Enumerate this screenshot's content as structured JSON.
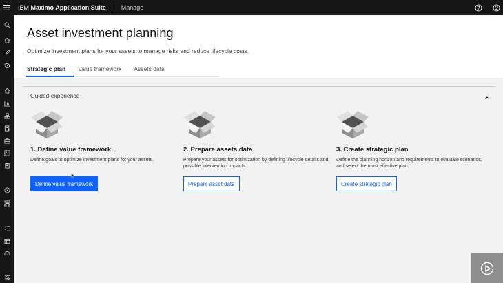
{
  "topbar": {
    "brand_prefix": "IBM",
    "brand_name": "Maximo Application Suite",
    "app_name": "Manage",
    "icons": [
      "menu-icon",
      "help-icon",
      "user-avatar-icon"
    ]
  },
  "rail": {
    "icons": [
      "search-icon",
      "home-icon",
      "rocket-icon",
      "recent-icon",
      "home-icon",
      "analytics-icon",
      "assets-icon",
      "work-order-icon",
      "toolbox-icon",
      "building-icon",
      "clipboard-icon",
      "compass-icon",
      "flow-icon",
      "checklist-icon",
      "table-icon",
      "gauge-icon",
      "settings-adjust-icon"
    ]
  },
  "page": {
    "title": "Asset investment planning",
    "subtitle": "Optimize investment plans for your assets to manage risks and reduce lifecycle costs."
  },
  "tabs": [
    {
      "label": "Strategic plan",
      "active": true
    },
    {
      "label": "Value framework",
      "active": false
    },
    {
      "label": "Assets data",
      "active": false
    }
  ],
  "guided": {
    "title": "Guided experience",
    "steps": [
      {
        "title": "1. Define value framework",
        "description": "Define goals to optimize investment plans for your assets.",
        "button": "Define value framework",
        "button_kind": "primary"
      },
      {
        "title": "2. Prepare assets data",
        "description": "Prepare your assets for optimization by defining lifecycle details and possible intervention impacts.",
        "button": "Prepare asset data",
        "button_kind": "tertiary"
      },
      {
        "title": "3. Create strategic plan",
        "description": "Define the planning horizon and requirements to evaluate scenarios, and select the most effective plan.",
        "button": "Create strategic plan",
        "button_kind": "tertiary"
      }
    ]
  },
  "colors": {
    "accent": "#0f62fe",
    "topbar": "#161616",
    "background": "#f2f2f2"
  }
}
